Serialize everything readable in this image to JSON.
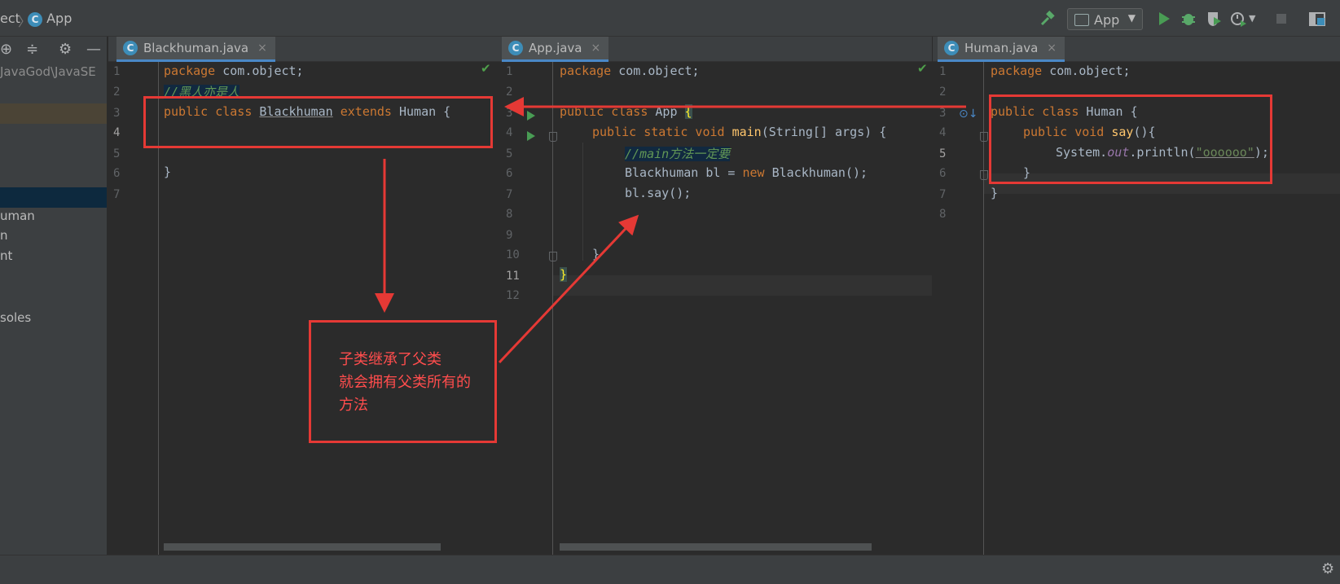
{
  "breadcrumb": {
    "project": "ect",
    "separator": "〉",
    "file": "App"
  },
  "run_config": {
    "label": "App"
  },
  "sidebar": {
    "path_fragment": "JavaGod\\JavaSE",
    "items": [
      "uman",
      "n",
      "nt",
      "soles"
    ]
  },
  "panes": {
    "left": {
      "tab_label": "Blackhuman.java",
      "close": "×",
      "lines": [
        "1",
        "2",
        "3",
        "4",
        "5",
        "6",
        "7"
      ],
      "code": {
        "l1_kw": "package",
        "l1_rest": " com.object;",
        "l2": "//黑人亦是人",
        "l3_kw1": "public class ",
        "l3_name": "Blackhuman",
        "l3_kw2": " extends ",
        "l3_rest": "Human {",
        "l6": "}"
      }
    },
    "middle": {
      "tab_label": "App.java",
      "close": "×",
      "lines": [
        "1",
        "2",
        "3",
        "4",
        "5",
        "6",
        "7",
        "8",
        "9",
        "10",
        "11",
        "12"
      ],
      "code": {
        "l1_kw": "package",
        "l1_rest": " com.object;",
        "l3_kw": "public class ",
        "l3_name": "App ",
        "l3_brace": "{",
        "l4_kw": "public static void ",
        "l4_fn": "main",
        "l4_rest": "(String[] args) {",
        "l5": "//main方法一定要",
        "l6_a": "Blackhuman bl = ",
        "l6_kw": "new ",
        "l6_b": "Blackhuman();",
        "l7": "bl.say();",
        "l10": "}",
        "l11": "}"
      }
    },
    "right": {
      "tab_label": "Human.java",
      "close": "×",
      "lines": [
        "1",
        "2",
        "3",
        "4",
        "5",
        "6",
        "7",
        "8"
      ],
      "code": {
        "l1_kw": "package",
        "l1_rest": " com.object;",
        "l3_kw": "public class ",
        "l3_rest": "Human {",
        "l4_kw": "public void ",
        "l4_fn": "say",
        "l4_rest": "(){",
        "l5_a": "System.",
        "l5_fld": "out",
        "l5_b": ".println(",
        "l5_str": "\"oooooo\"",
        "l5_c": ");",
        "l6": "}",
        "l7": "}"
      }
    }
  },
  "annotation": {
    "text": "子类继承了父类\n就会拥有父类所有的\n方法",
    "color": "#e53935"
  },
  "colors": {
    "keyword": "#cc7832",
    "comment": "#629755",
    "function": "#ffc66d",
    "string": "#6a8759",
    "annotation_red": "#e53935"
  },
  "icons": [
    "hammer-icon",
    "run-icon",
    "debug-icon",
    "coverage-icon",
    "profile-icon",
    "stop-icon",
    "project-structure-icon",
    "settings-icon",
    "target-icon",
    "collapse-icon",
    "gear-icon",
    "minimize-icon",
    "class-icon",
    "check-icon"
  ]
}
